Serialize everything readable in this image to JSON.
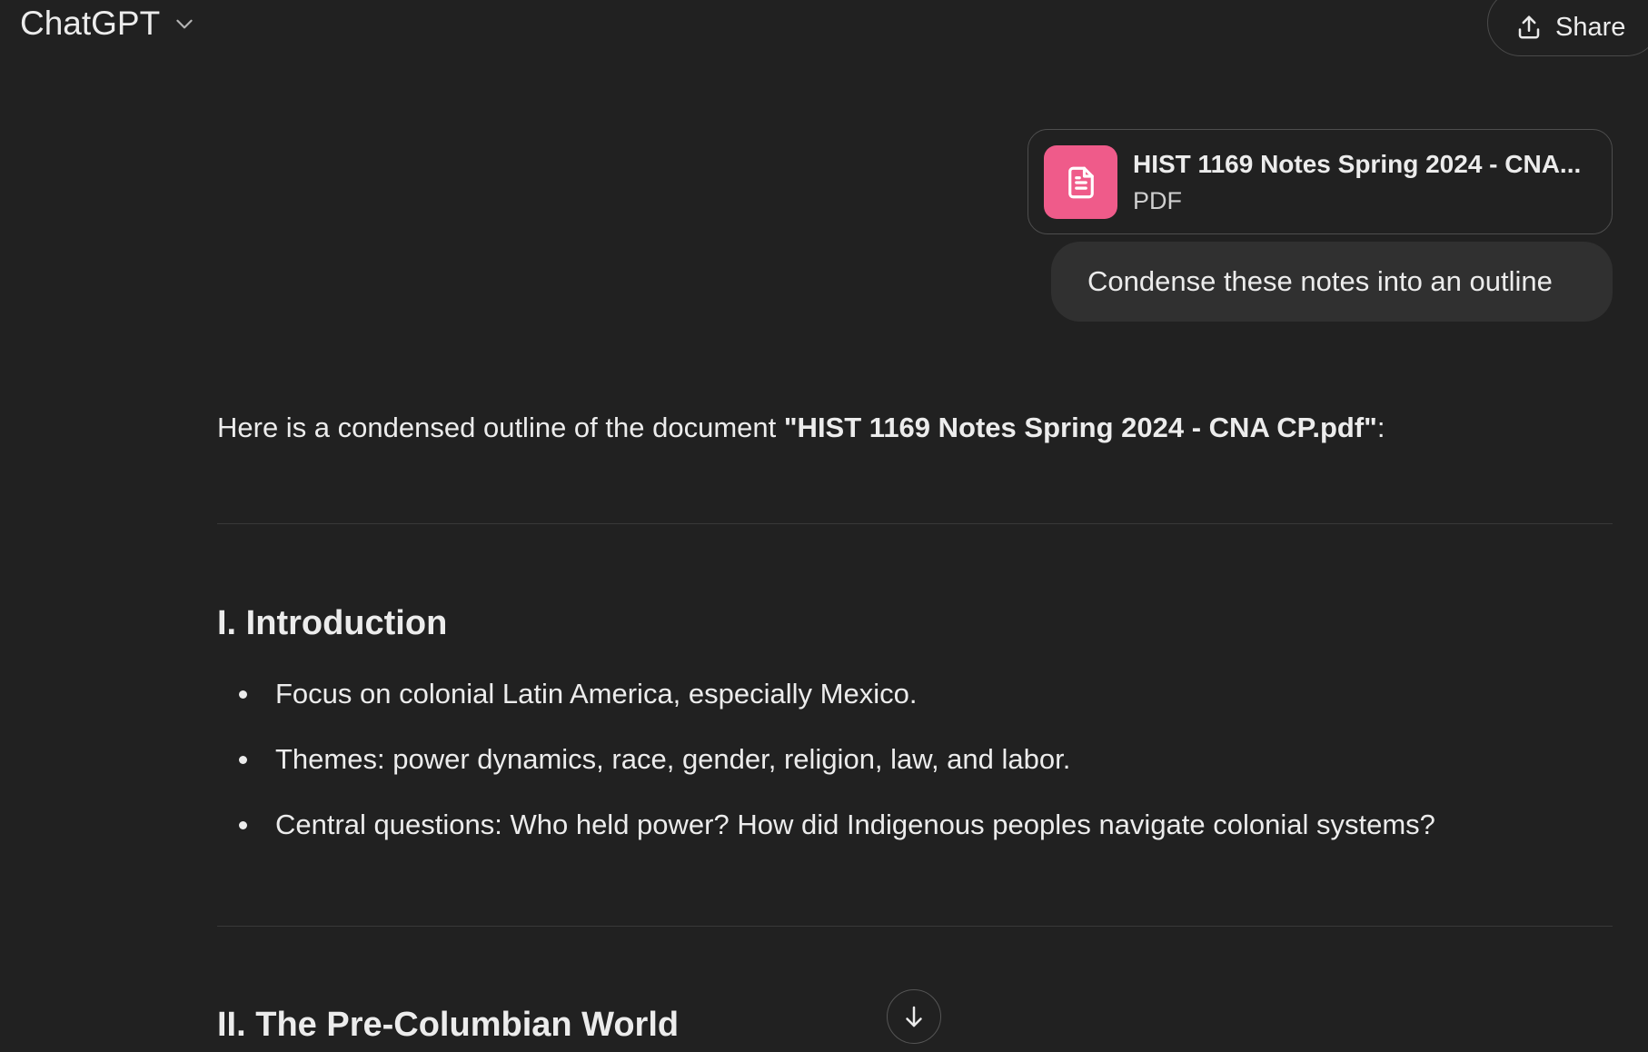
{
  "header": {
    "model_name": "ChatGPT",
    "share_label": "Share"
  },
  "user_message": {
    "attachment": {
      "file_name": "HIST 1169 Notes Spring 2024 - CNA CP.pdf",
      "file_name_display": "HIST 1169 Notes Spring 2024 - CNA...",
      "file_type": "PDF"
    },
    "text": "Condense these notes into an outline"
  },
  "assistant_message": {
    "intro_prefix": "Here is a condensed outline of the document ",
    "intro_bold": "\"HIST 1169 Notes Spring 2024 - CNA CP.pdf\"",
    "intro_suffix": ":",
    "sections": [
      {
        "title": "I. Introduction",
        "bullets": [
          "Focus on colonial Latin America, especially Mexico.",
          "Themes: power dynamics, race, gender, religion, law, and labor.",
          "Central questions: Who held power? How did Indigenous peoples navigate colonial systems?"
        ]
      },
      {
        "title": "II. The Pre-Columbian World",
        "bullets": []
      }
    ]
  },
  "icons": {
    "model_chevron": "chevron-down-icon",
    "share": "share-upload-icon",
    "file": "document-icon",
    "scroll": "arrow-down-icon"
  },
  "colors": {
    "background": "#212121",
    "user_bubble": "#303030",
    "file_icon_bg": "#ef5b8a",
    "text": "#ececec"
  }
}
